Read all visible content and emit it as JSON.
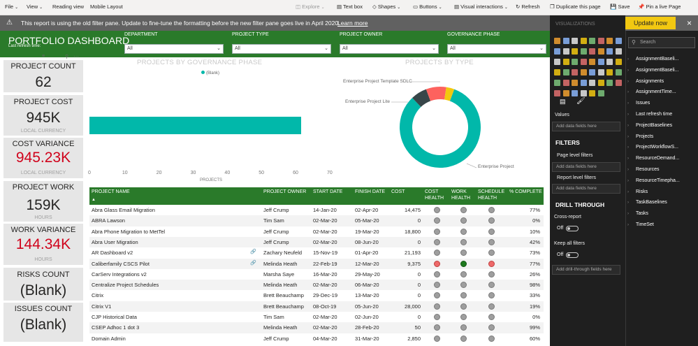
{
  "menu": {
    "file": "File",
    "view": "View",
    "reading_view": "Reading view",
    "mobile_layout": "Mobile Layout",
    "explore": "Explore",
    "text_box": "Text box",
    "shapes": "Shapes",
    "buttons": "Buttons",
    "visual_interactions": "Visual interactions",
    "refresh": "Refresh",
    "duplicate": "Duplicate this page",
    "save": "Save",
    "pin": "Pin a live Page"
  },
  "notice": {
    "text": "This report is using the old filter pane. Update to fine-tune the formatting before the new filter pane goes live in April 2020.",
    "link": "Learn more",
    "update_button": "Update now"
  },
  "header": {
    "title": "PORTFOLIO DASHBOARD",
    "subtitle": "Last refresh time:"
  },
  "slicers": [
    {
      "label": "DEPARTMENT",
      "value": "All"
    },
    {
      "label": "PROJECT TYPE",
      "value": "All"
    },
    {
      "label": "PROJECT OWNER",
      "value": "All"
    },
    {
      "label": "GOVERNANCE PHASE",
      "value": "All"
    }
  ],
  "cards": [
    {
      "label": "PROJECT COUNT",
      "value": "62",
      "sub": ""
    },
    {
      "label": "PROJECT COST",
      "value": "945K",
      "sub": "LOCAL CURRENCY"
    },
    {
      "label": "COST VARIANCE",
      "value": "945.23K",
      "sub": "LOCAL CURRENCY",
      "red": true
    },
    {
      "label": "PROJECT WORK",
      "value": "159K",
      "sub": "HOURS"
    },
    {
      "label": "WORK VARIANCE",
      "value": "144.34K",
      "sub": "HOURS",
      "red": true
    },
    {
      "label": "RISKS COUNT",
      "value": "(Blank)",
      "sub": ""
    },
    {
      "label": "ISSUES COUNT",
      "value": "(Blank)",
      "sub": ""
    }
  ],
  "chart_data": [
    {
      "type": "bar",
      "title": "PROJECTS BY GOVERNANCE PHASE",
      "categories": [
        "(Blank)"
      ],
      "values": [
        62
      ],
      "xlabel": "PROJECTS",
      "legend": [
        "(Blank)"
      ],
      "xlim": [
        0,
        70
      ],
      "xticks": [
        "0",
        "10",
        "20",
        "30",
        "40",
        "50",
        "60",
        "70"
      ],
      "colors": [
        "#01b8aa"
      ]
    },
    {
      "type": "pie",
      "title": "PROJECTS BY TYPE",
      "donut": true,
      "categories": [
        "Enterprise Project",
        "Enterprise Project Lite",
        "Enterprise Project Template SDLC"
      ],
      "values": [
        51,
        4,
        5
      ],
      "extra_slice": 2,
      "colors": [
        "#01b8aa",
        "#374649",
        "#fd625e",
        "#f2c80f"
      ]
    }
  ],
  "table": {
    "headers": [
      "PROJECT NAME",
      "PROJECT OWNER",
      "START DATE",
      "FINISH DATE",
      "COST",
      "COST HEALTH",
      "WORK HEALTH",
      "SCHEDULE HEALTH",
      "% COMPLETE"
    ],
    "rows": [
      {
        "name": "Abra Glass Email Migration",
        "owner": "Jeff Crump",
        "start": "14-Jan-20",
        "finish": "02-Apr-20",
        "cost": "14,475",
        "health": [
          "g",
          "g",
          "g"
        ],
        "pct": "77%"
      },
      {
        "name": "ABRA Lawson",
        "owner": "Tim Sam",
        "start": "02-Mar-20",
        "finish": "05-Mar-20",
        "cost": "0",
        "health": [
          "g",
          "g",
          "g"
        ],
        "pct": "0%"
      },
      {
        "name": "Abra Phone Migration to MetTel",
        "owner": "Jeff Crump",
        "start": "02-Mar-20",
        "finish": "19-Mar-20",
        "cost": "18,800",
        "health": [
          "g",
          "g",
          "g"
        ],
        "pct": "10%"
      },
      {
        "name": "Abra User Migration",
        "owner": "Jeff Crump",
        "start": "02-Mar-20",
        "finish": "08-Jun-20",
        "cost": "0",
        "health": [
          "g",
          "g",
          "g"
        ],
        "pct": "42%"
      },
      {
        "name": "AR Dashboard v2",
        "owner": "Zachary Neufeld",
        "start": "15-Nov-19",
        "finish": "01-Apr-20",
        "cost": "21,193",
        "health": [
          "g",
          "g",
          "g"
        ],
        "pct": "73%",
        "link": true
      },
      {
        "name": "Caliberfamily CSCS Pilot",
        "owner": "Melinda Heath",
        "start": "22-Feb-19",
        "finish": "12-Mar-20",
        "cost": "9,375",
        "health": [
          "r",
          "gr",
          "r"
        ],
        "pct": "77%",
        "link": true
      },
      {
        "name": "CarServ Integrations v2",
        "owner": "Marsha Saye",
        "start": "16-Mar-20",
        "finish": "29-May-20",
        "cost": "0",
        "health": [
          "g",
          "g",
          "g"
        ],
        "pct": "26%"
      },
      {
        "name": "Centralize Project Schedules",
        "owner": "Melinda Heath",
        "start": "02-Mar-20",
        "finish": "06-Mar-20",
        "cost": "0",
        "health": [
          "g",
          "g",
          "g"
        ],
        "pct": "98%"
      },
      {
        "name": "Citrix",
        "owner": "Brett Beauchamp",
        "start": "29-Dec-19",
        "finish": "13-Mar-20",
        "cost": "0",
        "health": [
          "g",
          "g",
          "g"
        ],
        "pct": "33%"
      },
      {
        "name": "Citrix V1",
        "owner": "Brett Beauchamp",
        "start": "08-Oct-19",
        "finish": "05-Jun-20",
        "cost": "28,000",
        "health": [
          "g",
          "g",
          "g"
        ],
        "pct": "19%"
      },
      {
        "name": "CJP Historical Data",
        "owner": "Tim Sam",
        "start": "02-Mar-20",
        "finish": "02-Jun-20",
        "cost": "0",
        "health": [
          "g",
          "g",
          "g"
        ],
        "pct": "0%"
      },
      {
        "name": "CSEP Adhoc 1 dot 3",
        "owner": "Melinda Heath",
        "start": "02-Mar-20",
        "finish": "28-Feb-20",
        "cost": "50",
        "health": [
          "g",
          "g",
          "g"
        ],
        "pct": "99%"
      },
      {
        "name": "Domain Admin",
        "owner": "Jeff Crump",
        "start": "04-Mar-20",
        "finish": "31-Mar-20",
        "cost": "2,850",
        "health": [
          "g",
          "g",
          "g"
        ],
        "pct": "60%"
      }
    ]
  },
  "viz_pane": {
    "title": "VISUALIZATIONS",
    "values": "Values",
    "add_fields": "Add data fields here",
    "filters": "FILTERS",
    "page_filters": "Page level filters",
    "report_filters": "Report level filters",
    "drill": "DRILL THROUGH",
    "cross_report": "Cross-report",
    "off": "Off",
    "keep_filters": "Keep all filters",
    "add_drill": "Add drill-through fields here"
  },
  "fields_pane": {
    "search": "Search",
    "items": [
      "AssignmentBaseli...",
      "AssignmentBaseli...",
      "Assignments",
      "AssignmentTime...",
      "Issues",
      "Last refresh time",
      "ProjectBaselines",
      "Projects",
      "ProjectWorkflowS...",
      "ResourceDemand...",
      "Resources",
      "ResourceTimepha...",
      "Risks",
      "TaskBaselines",
      "Tasks",
      "TimeSet"
    ]
  }
}
